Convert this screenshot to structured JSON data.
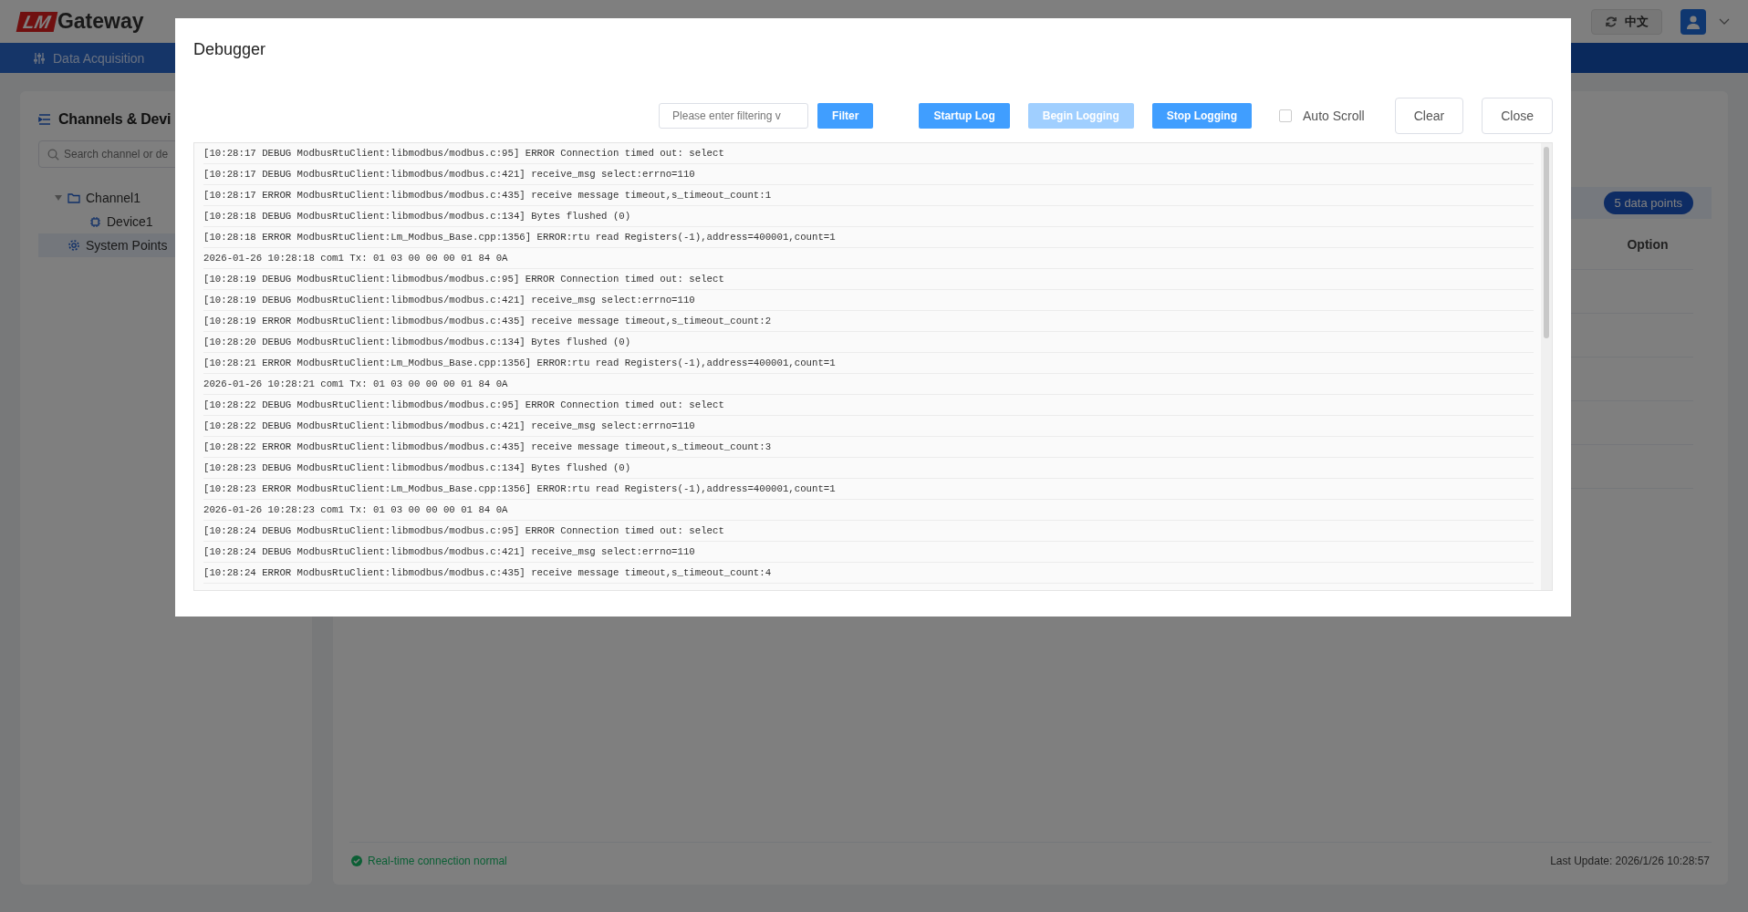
{
  "header": {
    "logo": {
      "mark": "LM",
      "name": "Gateway"
    },
    "language": "中文"
  },
  "nav": [
    {
      "label": "Data Acquisition",
      "selected": true
    }
  ],
  "sidebar": {
    "title": "Channels & Devi",
    "search": {
      "placeholder": "Search channel or de"
    },
    "tree": [
      {
        "kind": "folder",
        "label": "Channel1",
        "expanded": true,
        "selected": false,
        "children": [
          {
            "kind": "device",
            "label": "Device1",
            "selected": false
          }
        ]
      },
      {
        "kind": "system",
        "label": "System Points",
        "selected": true
      }
    ]
  },
  "content": {
    "badge": "5 data points",
    "table": {
      "columns": [
        "Option"
      ]
    },
    "status_bar": {
      "connection": "Real-time connection normal",
      "last_update": "Last Update: 2026/1/26 10:28:57"
    }
  },
  "modal": {
    "title": "Debugger",
    "toolbar": [
      {
        "kind": "field",
        "placeholder": "Please enter filtering v"
      },
      {
        "kind": "button",
        "label": "Filter",
        "disabled": false
      },
      {
        "kind": "button",
        "label": "Startup Log",
        "disabled": false
      },
      {
        "kind": "button",
        "label": "Begin Logging",
        "disabled": true
      },
      {
        "kind": "button",
        "label": "Stop Logging",
        "disabled": false
      },
      {
        "kind": "checkbox",
        "label": "Auto Scroll",
        "checked": false
      },
      {
        "kind": "outline-button",
        "label": "Clear",
        "disabled": false
      },
      {
        "kind": "outline-button",
        "label": "Close",
        "disabled": false
      }
    ],
    "log": [
      "[10:28:17 DEBUG ModbusRtuClient:libmodbus/modbus.c:95] ERROR Connection timed out: select",
      "[10:28:17 DEBUG ModbusRtuClient:libmodbus/modbus.c:421] receive_msg select:errno=110",
      "[10:28:17 ERROR ModbusRtuClient:libmodbus/modbus.c:435] receive message timeout,s_timeout_count:1",
      "[10:28:18 DEBUG ModbusRtuClient:libmodbus/modbus.c:134] Bytes flushed (0)",
      "[10:28:18 ERROR ModbusRtuClient:Lm_Modbus_Base.cpp:1356] ERROR:rtu read Registers(-1),address=400001,count=1",
      "2026-01-26 10:28:18 com1 Tx: 01 03 00 00 00 01 84 0A",
      "[10:28:19 DEBUG ModbusRtuClient:libmodbus/modbus.c:95] ERROR Connection timed out: select",
      "[10:28:19 DEBUG ModbusRtuClient:libmodbus/modbus.c:421] receive_msg select:errno=110",
      "[10:28:19 ERROR ModbusRtuClient:libmodbus/modbus.c:435] receive message timeout,s_timeout_count:2",
      "[10:28:20 DEBUG ModbusRtuClient:libmodbus/modbus.c:134] Bytes flushed (0)",
      "[10:28:21 ERROR ModbusRtuClient:Lm_Modbus_Base.cpp:1356] ERROR:rtu read Registers(-1),address=400001,count=1",
      "2026-01-26 10:28:21 com1 Tx: 01 03 00 00 00 01 84 0A",
      "[10:28:22 DEBUG ModbusRtuClient:libmodbus/modbus.c:95] ERROR Connection timed out: select",
      "[10:28:22 DEBUG ModbusRtuClient:libmodbus/modbus.c:421] receive_msg select:errno=110",
      "[10:28:22 ERROR ModbusRtuClient:libmodbus/modbus.c:435] receive message timeout,s_timeout_count:3",
      "[10:28:23 DEBUG ModbusRtuClient:libmodbus/modbus.c:134] Bytes flushed (0)",
      "[10:28:23 ERROR ModbusRtuClient:Lm_Modbus_Base.cpp:1356] ERROR:rtu read Registers(-1),address=400001,count=1",
      "2026-01-26 10:28:23 com1 Tx: 01 03 00 00 00 01 84 0A",
      "[10:28:24 DEBUG ModbusRtuClient:libmodbus/modbus.c:95] ERROR Connection timed out: select",
      "[10:28:24 DEBUG ModbusRtuClient:libmodbus/modbus.c:421] receive_msg select:errno=110",
      "[10:28:24 ERROR ModbusRtuClient:libmodbus/modbus.c:435] receive message timeout,s_timeout_count:4"
    ]
  }
}
